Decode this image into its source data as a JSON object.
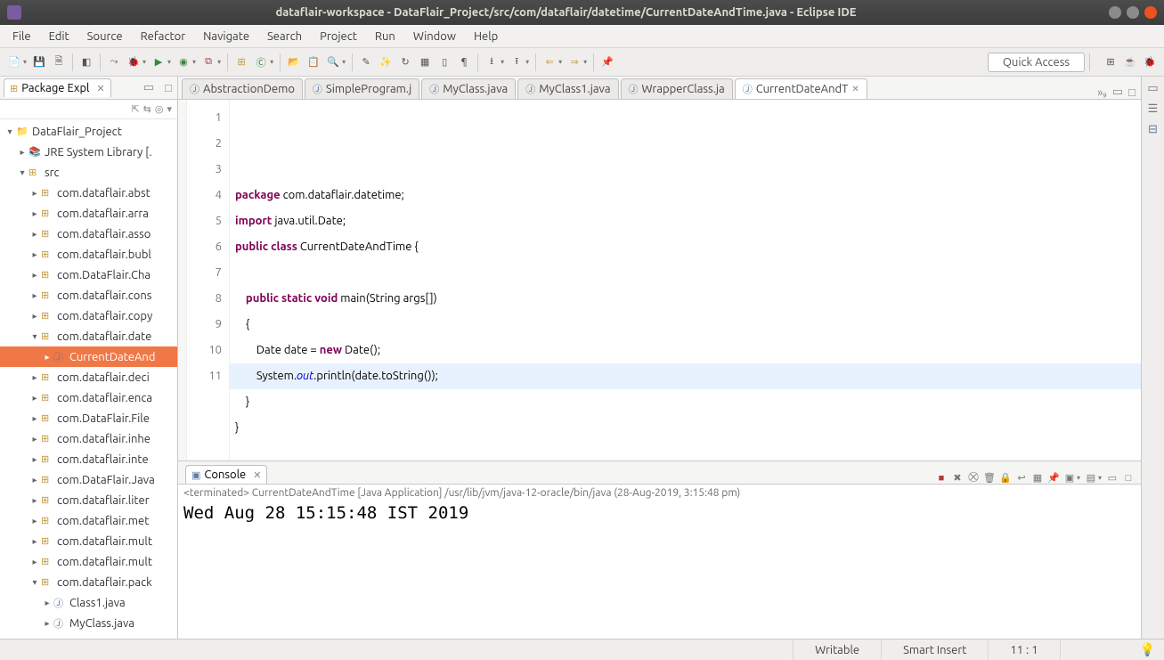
{
  "window": {
    "title": "dataflair-workspace - DataFlair_Project/src/com/dataflair/datetime/CurrentDateAndTime.java - Eclipse IDE"
  },
  "menu": {
    "items": [
      "File",
      "Edit",
      "Source",
      "Refactor",
      "Navigate",
      "Search",
      "Project",
      "Run",
      "Window",
      "Help"
    ]
  },
  "quick_access": "Quick Access",
  "package_explorer": {
    "title": "Package Expl",
    "project": "DataFlair_Project",
    "jre": "JRE System Library [.",
    "src": "src",
    "packages": [
      "com.dataflair.abst",
      "com.dataflair.arra",
      "com.dataflair.asso",
      "com.dataflair.bubl",
      "com.DataFlair.Cha",
      "com.dataflair.cons",
      "com.dataflair.copy",
      "com.dataflair.date",
      "com.dataflair.deci",
      "com.dataflair.enca",
      "com.DataFlair.File",
      "com.dataflair.inhe",
      "com.dataflair.inte",
      "com.DataFlair.Java",
      "com.dataflair.liter",
      "com.dataflair.met",
      "com.dataflair.mult",
      "com.dataflair.mult",
      "com.dataflair.pack"
    ],
    "selected_file": "CurrentDateAnd",
    "pack_children": [
      "Class1.java",
      "MyClass.java"
    ]
  },
  "editor_tabs": {
    "tabs": [
      {
        "label": "AbstractionDemo"
      },
      {
        "label": "SimpleProgram.j"
      },
      {
        "label": "MyClass.java"
      },
      {
        "label": "MyClass1.java"
      },
      {
        "label": "WrapperClass.ja"
      },
      {
        "label": "CurrentDateAndT"
      }
    ],
    "overflow": "»₉"
  },
  "code": {
    "lines": [
      "1",
      "2",
      "3",
      "4",
      "5",
      "6",
      "7",
      "8",
      "9",
      "10",
      "11"
    ]
  },
  "console": {
    "title": "Console",
    "header": "<terminated> CurrentDateAndTime [Java Application] /usr/lib/jvm/java-12-oracle/bin/java (28-Aug-2019, 3:15:48 pm)",
    "output": "Wed Aug 28 15:15:48 IST 2019"
  },
  "status": {
    "writable": "Writable",
    "insert": "Smart Insert",
    "pos": "11 : 1"
  }
}
